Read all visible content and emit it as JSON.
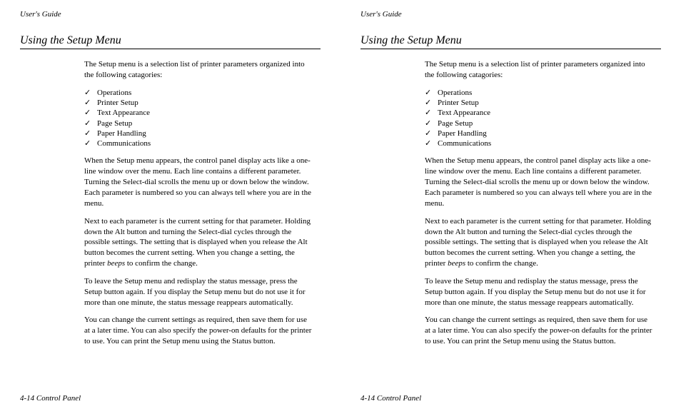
{
  "header": "User's Guide",
  "section_title": "Using the Setup Menu",
  "intro": "The Setup menu is a selection list of printer parameters organized into the following catagories:",
  "categories": [
    "Operations",
    "Printer Setup",
    "Text  Appearance",
    "Page  Setup",
    "Paper Handling",
    "Communications"
  ],
  "p1": "When the Setup menu appears, the control panel display acts like a one-line window over the menu.  Each line contains a different parameter.  Turning the Select-dial scrolls the menu up or down below the window.  Each parameter is numbered so you can always tell where you are in the menu.",
  "p2_a": "Next to each parameter is the current setting for that parameter.  Holding down the Alt button and turning the Select-dial cycles through the possible settings.  The setting that is displayed when you release the Alt button becomes the current setting.   When you change a setting, the printer ",
  "p2_italic": "beeps",
  "p2_b": " to confirm the change.",
  "p3": "To leave the Setup menu and redisplay the status message, press the Setup button again.  If you display the Setup menu but do not use it for more than one minute, the status message reappears automatically.",
  "p4": "You can change the current settings as required, then save them for use at a later time.  You can also specify the power-on defaults for the printer to use.  You can print the Setup menu using the Status button.",
  "footer": "4-14 Control Panel"
}
